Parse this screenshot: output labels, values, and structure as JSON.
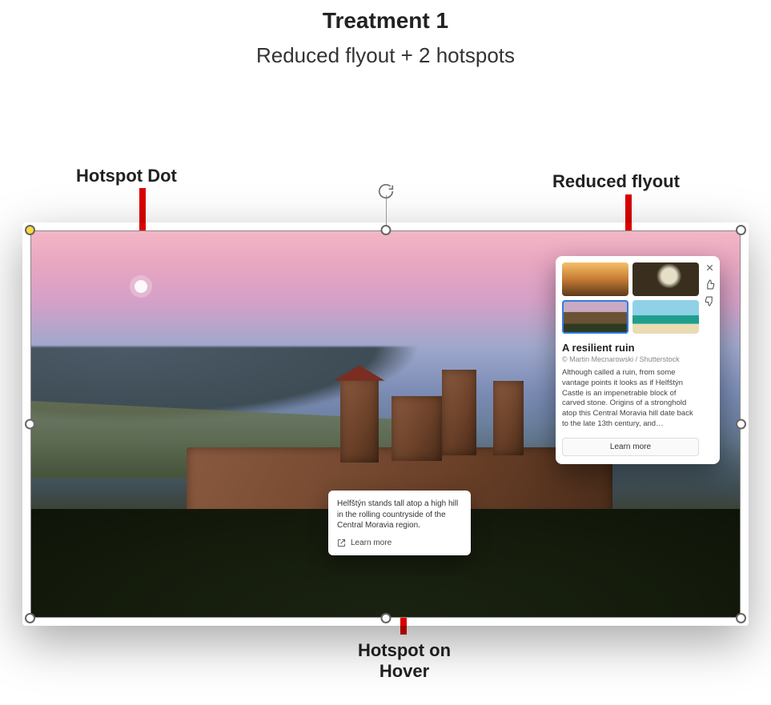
{
  "header": {
    "title": "Treatment 1",
    "subtitle": "Reduced flyout + 2 hotspots"
  },
  "labels": {
    "hotspot_dot": "Hotspot Dot",
    "reduced_flyout": "Reduced flyout",
    "hotspot_hover_l1": "Hotspot on",
    "hotspot_hover_l2": "Hover"
  },
  "hover_card": {
    "text": "Helfštýn stands tall atop a high hill in the rolling countryside of the Central Moravia region.",
    "learn_more": "Learn more"
  },
  "flyout": {
    "title": "A resilient ruin",
    "credit": "© Martin Mecnarowski / Shutterstock",
    "body": "Although called a ruin, from some vantage points it looks as if Helfštýn Castle is an impenetrable block of carved stone. Origins of a stronghold atop this Central Moravia hill date back to the late 13th century, and…",
    "learn_more": "Learn more"
  },
  "icons": {
    "close": "close-icon",
    "like": "thumbs-up-icon",
    "dislike": "thumbs-down-icon",
    "external": "external-link-icon",
    "rotate": "rotate-handle-icon"
  }
}
